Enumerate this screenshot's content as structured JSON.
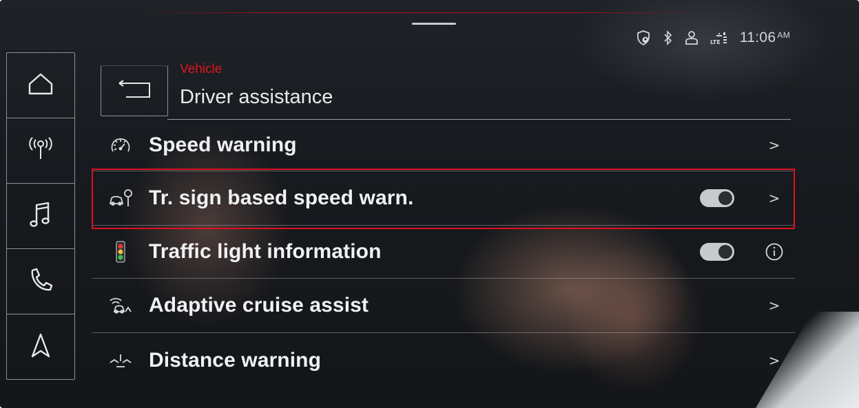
{
  "status_bar": {
    "icons": [
      "shield-location-icon",
      "bluetooth-icon",
      "user-profile-icon",
      "lte-signal-icon"
    ],
    "time": "11:06",
    "ampm": "AM"
  },
  "nav": {
    "items": [
      {
        "name": "home-icon"
      },
      {
        "name": "radio-icon"
      },
      {
        "name": "music-icon"
      },
      {
        "name": "phone-icon"
      },
      {
        "name": "navigation-icon"
      }
    ]
  },
  "header": {
    "breadcrumb": "Vehicle",
    "title": "Driver assistance",
    "back_icon": "back-arrow-icon"
  },
  "list": {
    "items": [
      {
        "label": "Speed warning",
        "icon": "speedometer-icon",
        "toggle": null,
        "trailing": ">"
      },
      {
        "label": "Tr. sign based speed warn.",
        "icon": "traffic-sign-car-icon",
        "toggle": true,
        "trailing": ">",
        "selected": true
      },
      {
        "label": "Traffic light information",
        "icon": "traffic-light-icon",
        "toggle": true,
        "trailing": "info"
      },
      {
        "label": "Adaptive cruise assist",
        "icon": "adaptive-cruise-icon",
        "toggle": null,
        "trailing": ">"
      },
      {
        "label": "Distance warning",
        "icon": "distance-warning-icon",
        "toggle": null,
        "trailing": ">"
      }
    ]
  },
  "colors": {
    "accent_red": "#e2141f",
    "text": "#f0f1f3",
    "background": "#171a1e",
    "toggle_on": "#c8cacd"
  }
}
